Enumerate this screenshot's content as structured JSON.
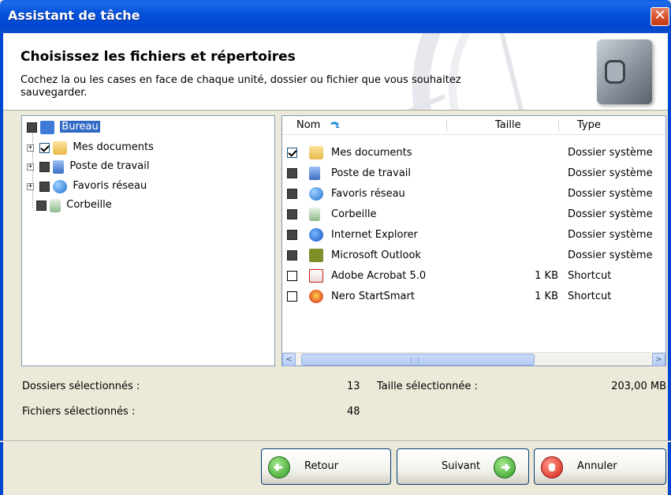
{
  "window": {
    "title": "Assistant de tâche",
    "close_glyph": "✕"
  },
  "header": {
    "title": "Choisissez les fichiers et répertoires",
    "description": "Cochez la ou les cases en face de chaque unité, dossier ou fichier que vous souhaitez sauvegarder."
  },
  "tree": {
    "items": [
      {
        "label": "Bureau",
        "icon": "desktop-icon",
        "check": "partial",
        "expander": ""
      },
      {
        "label": "Mes documents",
        "icon": "folder-icon",
        "check": "checked",
        "expander": "+"
      },
      {
        "label": "Poste de travail",
        "icon": "computer-icon",
        "check": "partial",
        "expander": "+"
      },
      {
        "label": "Favoris réseau",
        "icon": "globe-icon",
        "check": "partial",
        "expander": "+"
      },
      {
        "label": "Corbeille",
        "icon": "recycle-bin-icon",
        "check": "partial",
        "expander": ""
      }
    ]
  },
  "list": {
    "columns": {
      "name": "Nom",
      "size": "Taille",
      "type": "Type"
    },
    "rows": [
      {
        "name": "Mes documents",
        "size": "",
        "type": "Dossier système",
        "check": "checked",
        "icon": "folder-icon"
      },
      {
        "name": "Poste de travail",
        "size": "",
        "type": "Dossier système",
        "check": "partial",
        "icon": "computer-icon"
      },
      {
        "name": "Favoris réseau",
        "size": "",
        "type": "Dossier système",
        "check": "partial",
        "icon": "globe-icon"
      },
      {
        "name": "Corbeille",
        "size": "",
        "type": "Dossier système",
        "check": "partial",
        "icon": "recycle-bin-icon"
      },
      {
        "name": "Internet Explorer",
        "size": "",
        "type": "Dossier système",
        "check": "partial",
        "icon": "internet-explorer-icon"
      },
      {
        "name": "Microsoft Outlook",
        "size": "",
        "type": "Dossier système",
        "check": "partial",
        "icon": "outlook-icon"
      },
      {
        "name": "Adobe Acrobat 5.0",
        "size": "1 KB",
        "type": "Shortcut",
        "check": "empty",
        "icon": "acrobat-icon"
      },
      {
        "name": "Nero StartSmart",
        "size": "1 KB",
        "type": "Shortcut",
        "check": "empty",
        "icon": "nero-icon"
      }
    ],
    "scroll_left_glyph": "<",
    "scroll_right_glyph": ">",
    "scroll_grip": "III"
  },
  "stats": {
    "folders_label": "Dossiers sélectionnés :",
    "folders_value": "13",
    "size_label": "Taille sélectionnée :",
    "size_value": "203,00 MB",
    "files_label": "Fichiers sélectionnés :",
    "files_value": "48"
  },
  "buttons": {
    "back": "Retour",
    "next": "Suivant",
    "cancel": "Annuler"
  },
  "colors": {
    "titlebar": "#0046D0",
    "selection": "#316AC5",
    "dialog_bg": "#ECE9D8"
  }
}
